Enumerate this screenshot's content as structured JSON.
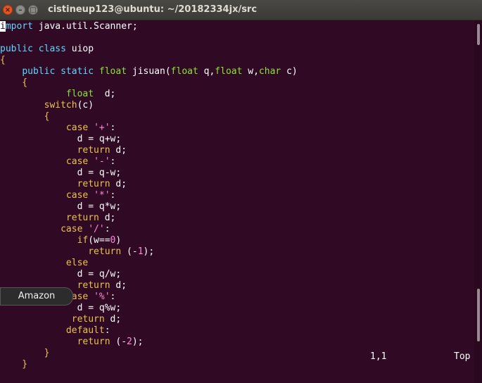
{
  "window": {
    "title": "cistineup123@ubuntu: ~/20182334jx/src",
    "close_glyph": "×",
    "min_glyph": "–",
    "max_glyph": "□"
  },
  "editor": {
    "lines": [
      {
        "parts": [
          {
            "t": "i",
            "c": "cursor kw"
          },
          {
            "t": "mport",
            "c": "kw"
          },
          {
            "t": " java.util.Scanner;",
            "c": ""
          }
        ]
      },
      {
        "parts": []
      },
      {
        "parts": [
          {
            "t": "public",
            "c": "kw"
          },
          {
            "t": " ",
            "c": ""
          },
          {
            "t": "class",
            "c": "kw"
          },
          {
            "t": " uiop",
            "c": ""
          }
        ]
      },
      {
        "parts": [
          {
            "t": "{",
            "c": "kw2"
          }
        ]
      },
      {
        "parts": [
          {
            "t": "    ",
            "c": ""
          },
          {
            "t": "public",
            "c": "kw"
          },
          {
            "t": " ",
            "c": ""
          },
          {
            "t": "static",
            "c": "kw"
          },
          {
            "t": " ",
            "c": ""
          },
          {
            "t": "float",
            "c": "ty"
          },
          {
            "t": " jisuan(",
            "c": ""
          },
          {
            "t": "float",
            "c": "ty"
          },
          {
            "t": " q,",
            "c": ""
          },
          {
            "t": "float",
            "c": "ty"
          },
          {
            "t": " w,",
            "c": ""
          },
          {
            "t": "char",
            "c": "ty"
          },
          {
            "t": " c)",
            "c": ""
          }
        ]
      },
      {
        "parts": [
          {
            "t": "    {",
            "c": "kw2"
          }
        ]
      },
      {
        "parts": [
          {
            "t": "            ",
            "c": ""
          },
          {
            "t": "float",
            "c": "ty"
          },
          {
            "t": "  d;",
            "c": ""
          }
        ]
      },
      {
        "parts": [
          {
            "t": "        ",
            "c": ""
          },
          {
            "t": "switch",
            "c": "kw2"
          },
          {
            "t": "(c)",
            "c": ""
          }
        ]
      },
      {
        "parts": [
          {
            "t": "        {",
            "c": "kw2"
          }
        ]
      },
      {
        "parts": [
          {
            "t": "            ",
            "c": ""
          },
          {
            "t": "case",
            "c": "kw2"
          },
          {
            "t": " ",
            "c": ""
          },
          {
            "t": "'+'",
            "c": "str"
          },
          {
            "t": ":",
            "c": ""
          }
        ]
      },
      {
        "parts": [
          {
            "t": "              d = q+w;",
            "c": ""
          }
        ]
      },
      {
        "parts": [
          {
            "t": "              ",
            "c": ""
          },
          {
            "t": "return",
            "c": "kw2"
          },
          {
            "t": " d;",
            "c": ""
          }
        ]
      },
      {
        "parts": [
          {
            "t": "            ",
            "c": ""
          },
          {
            "t": "case",
            "c": "kw2"
          },
          {
            "t": " ",
            "c": ""
          },
          {
            "t": "'-'",
            "c": "str"
          },
          {
            "t": ":",
            "c": ""
          }
        ]
      },
      {
        "parts": [
          {
            "t": "              d = q-w;",
            "c": ""
          }
        ]
      },
      {
        "parts": [
          {
            "t": "              ",
            "c": ""
          },
          {
            "t": "return",
            "c": "kw2"
          },
          {
            "t": " d;",
            "c": ""
          }
        ]
      },
      {
        "parts": [
          {
            "t": "            ",
            "c": ""
          },
          {
            "t": "case",
            "c": "kw2"
          },
          {
            "t": " ",
            "c": ""
          },
          {
            "t": "'*'",
            "c": "str"
          },
          {
            "t": ":",
            "c": ""
          }
        ]
      },
      {
        "parts": [
          {
            "t": "              d = q*w;",
            "c": ""
          }
        ]
      },
      {
        "parts": [
          {
            "t": "            ",
            "c": ""
          },
          {
            "t": "return",
            "c": "kw2"
          },
          {
            "t": " d;",
            "c": ""
          }
        ]
      },
      {
        "parts": [
          {
            "t": "           ",
            "c": ""
          },
          {
            "t": "case",
            "c": "kw2"
          },
          {
            "t": " ",
            "c": ""
          },
          {
            "t": "'/'",
            "c": "str"
          },
          {
            "t": ":",
            "c": ""
          }
        ]
      },
      {
        "parts": [
          {
            "t": "              ",
            "c": ""
          },
          {
            "t": "if",
            "c": "kw2"
          },
          {
            "t": "(w==",
            "c": ""
          },
          {
            "t": "0",
            "c": "num"
          },
          {
            "t": ")",
            "c": ""
          }
        ]
      },
      {
        "parts": [
          {
            "t": "                ",
            "c": ""
          },
          {
            "t": "return",
            "c": "kw2"
          },
          {
            "t": " (-",
            "c": ""
          },
          {
            "t": "1",
            "c": "num"
          },
          {
            "t": ");",
            "c": ""
          }
        ]
      },
      {
        "parts": [
          {
            "t": "            ",
            "c": ""
          },
          {
            "t": "else",
            "c": "kw2"
          }
        ]
      },
      {
        "parts": [
          {
            "t": "              d = q/w;",
            "c": ""
          }
        ]
      },
      {
        "parts": [
          {
            "t": "              ",
            "c": ""
          },
          {
            "t": "return",
            "c": "kw2"
          },
          {
            "t": " d;",
            "c": ""
          }
        ]
      },
      {
        "parts": [
          {
            "t": "            ",
            "c": ""
          },
          {
            "t": "case",
            "c": "kw2"
          },
          {
            "t": " ",
            "c": ""
          },
          {
            "t": "'%'",
            "c": "str"
          },
          {
            "t": ":",
            "c": ""
          }
        ]
      },
      {
        "parts": [
          {
            "t": "              d = q%w;",
            "c": ""
          }
        ]
      },
      {
        "parts": [
          {
            "t": "             ",
            "c": ""
          },
          {
            "t": "return",
            "c": "kw2"
          },
          {
            "t": " d;",
            "c": ""
          }
        ]
      },
      {
        "parts": [
          {
            "t": "            ",
            "c": ""
          },
          {
            "t": "default",
            "c": "kw2"
          },
          {
            "t": ":",
            "c": ""
          }
        ]
      },
      {
        "parts": [
          {
            "t": "              ",
            "c": ""
          },
          {
            "t": "return",
            "c": "kw2"
          },
          {
            "t": " (-",
            "c": ""
          },
          {
            "t": "2",
            "c": "num"
          },
          {
            "t": ");",
            "c": ""
          }
        ]
      },
      {
        "parts": [
          {
            "t": "        }",
            "c": "kw2"
          }
        ]
      },
      {
        "parts": [
          {
            "t": "    }",
            "c": "kw2"
          }
        ]
      }
    ],
    "status_position": "1,1",
    "status_scroll": "Top"
  },
  "tooltip": {
    "label": "Amazon"
  }
}
